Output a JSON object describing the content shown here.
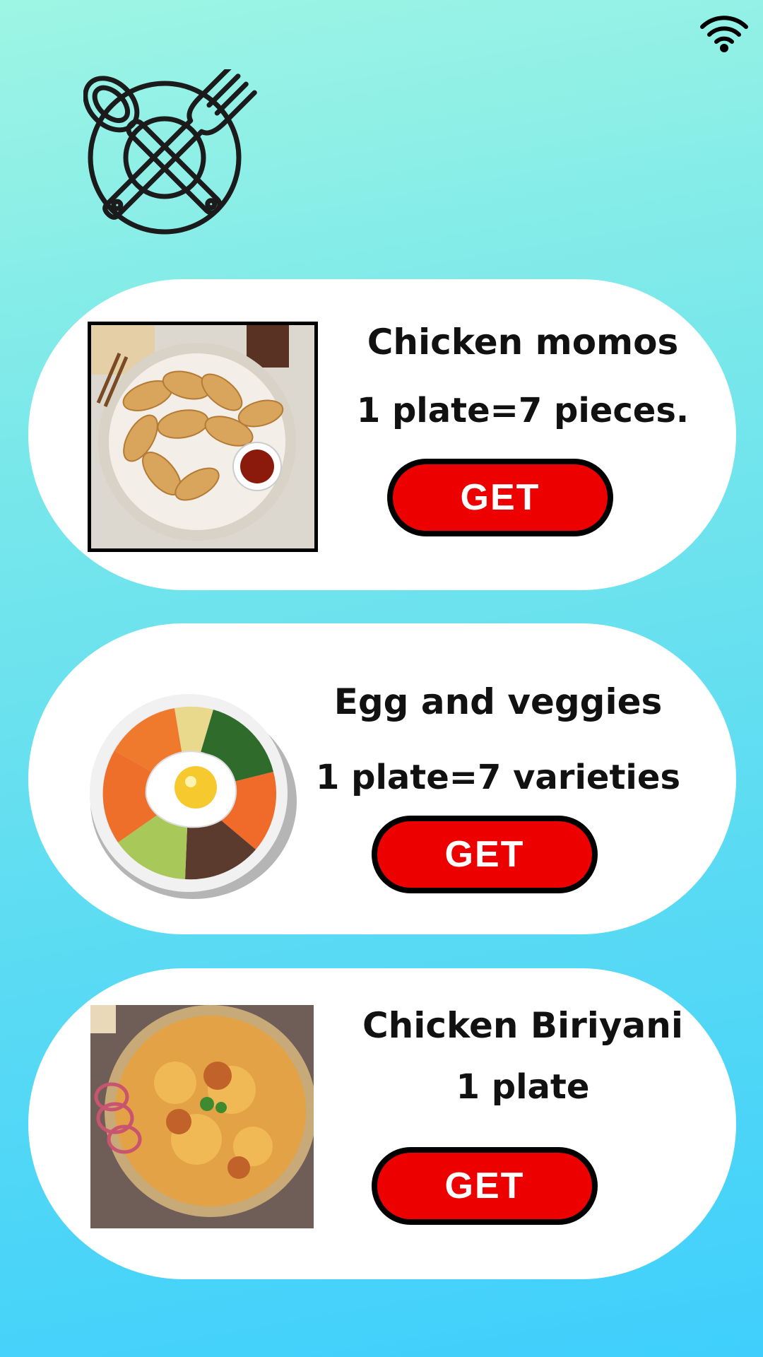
{
  "status_bar": {
    "wifi_icon": "wifi-icon"
  },
  "header": {
    "logo_icon": "plate-fork-spoon-icon"
  },
  "colors": {
    "button": "#ec0000",
    "card": "#ffffff",
    "bg_top": "#9ef5e4",
    "bg_bottom": "#3fcffc"
  },
  "menu": {
    "items": [
      {
        "name": "Chicken momos",
        "detail": "1 plate=7 pieces.",
        "button": "GET",
        "image": "momos-photo"
      },
      {
        "name": "Egg and veggies",
        "detail": "1 plate=7 varieties",
        "button": "GET",
        "image": "bibimbap-illustration"
      },
      {
        "name": "Chicken Biriyani",
        "detail": "1 plate",
        "button": "GET",
        "image": "biriyani-photo"
      }
    ]
  }
}
